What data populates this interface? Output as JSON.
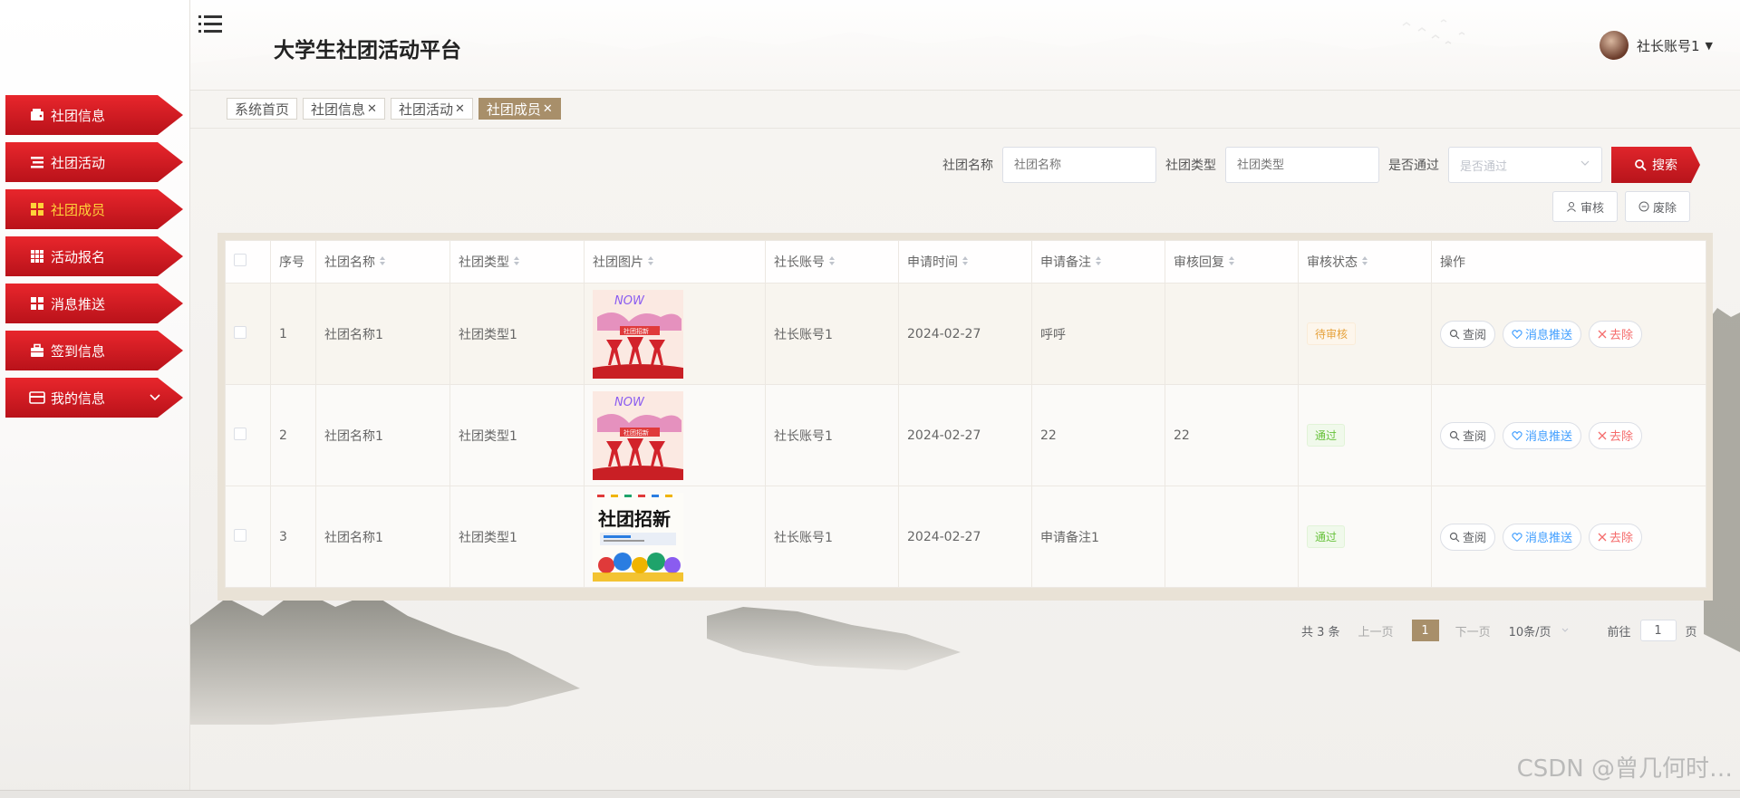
{
  "header": {
    "title": "大学生社团活动平台",
    "username": "社长账号1"
  },
  "sidebar": {
    "items": [
      {
        "label": "社团信息",
        "icon": "wallet-icon",
        "active": false
      },
      {
        "label": "社团活动",
        "icon": "list-icon",
        "active": false
      },
      {
        "label": "社团成员",
        "icon": "grid-icon",
        "active": true
      },
      {
        "label": "活动报名",
        "icon": "apps-icon",
        "active": false
      },
      {
        "label": "消息推送",
        "icon": "grid-icon",
        "active": false
      },
      {
        "label": "签到信息",
        "icon": "briefcase-icon",
        "active": false
      },
      {
        "label": "我的信息",
        "icon": "card-icon",
        "active": false,
        "expandable": true
      }
    ]
  },
  "tabs": [
    {
      "label": "系统首页",
      "closable": false,
      "active": false
    },
    {
      "label": "社团信息",
      "closable": true,
      "active": false
    },
    {
      "label": "社团活动",
      "closable": true,
      "active": false
    },
    {
      "label": "社团成员",
      "closable": true,
      "active": true
    }
  ],
  "search": {
    "name_label": "社团名称",
    "name_placeholder": "社团名称",
    "type_label": "社团类型",
    "type_placeholder": "社团类型",
    "pass_label": "是否通过",
    "pass_placeholder": "是否通过",
    "button_label": "搜索"
  },
  "actions": {
    "review_label": "审核",
    "discard_label": "废除"
  },
  "table": {
    "columns": [
      "序号",
      "社团名称",
      "社团类型",
      "社团图片",
      "社长账号",
      "申请时间",
      "申请备注",
      "审核回复",
      "审核状态",
      "操作"
    ],
    "rows": [
      {
        "index": "1",
        "name": "社团名称1",
        "type": "社团类型1",
        "image": "poster-dance",
        "account": "社长账号1",
        "time": "2024-02-27",
        "remark": "呼呼",
        "reply": "",
        "status": "待审核",
        "status_kind": "pending"
      },
      {
        "index": "2",
        "name": "社团名称1",
        "type": "社团类型1",
        "image": "poster-dance",
        "account": "社长账号1",
        "time": "2024-02-27",
        "remark": "22",
        "reply": "22",
        "status": "通过",
        "status_kind": "pass"
      },
      {
        "index": "3",
        "name": "社团名称1",
        "type": "社团类型1",
        "image": "poster-recruit",
        "account": "社长账号1",
        "time": "2024-02-27",
        "remark": "申请备注1",
        "reply": "",
        "status": "通过",
        "status_kind": "pass"
      }
    ],
    "row_actions": {
      "view": "查阅",
      "push": "消息推送",
      "remove": "去除"
    },
    "poster_text": {
      "dance_top": "NOW",
      "dance_banner": "社团招新",
      "recruit": "社团招新"
    }
  },
  "pagination": {
    "total": "共 3 条",
    "prev": "上一页",
    "current": "1",
    "next": "下一页",
    "page_size": "10条/页",
    "goto_label": "前往",
    "goto_value": "1",
    "page_unit": "页"
  },
  "watermark": "CSDN @曾几何时…",
  "colors": {
    "brand_red": "#c8161d",
    "active_gold": "#a88f6a",
    "active_menu_text": "#ffd23a"
  }
}
